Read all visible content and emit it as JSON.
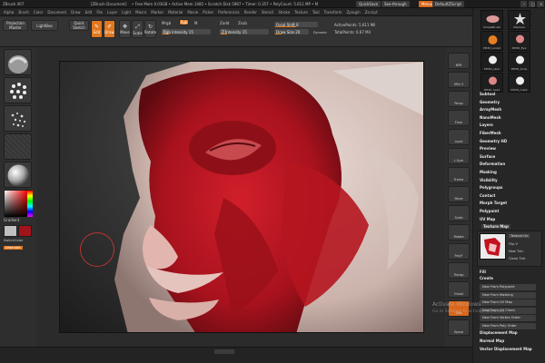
{
  "titlebar": {
    "app": "ZBrush 4R7",
    "doc": "[ZBrush Document]",
    "stats": "• Free Mem 0.03GB • Active Mem 1485 • Scratch Disk 5987 • Timer: 0.357 • PolyCount: 5.611 MP • M",
    "quicksave": "QuickSave",
    "seethrough": "See-through",
    "menus": "Menus",
    "defaultzscript": "DefaultZScript"
  },
  "menubar": [
    "Alpha",
    "Brush",
    "Color",
    "Document",
    "Draw",
    "Edit",
    "File",
    "Layer",
    "Light",
    "Macro",
    "Marker",
    "Material",
    "Movie",
    "Picker",
    "Preferences",
    "Render",
    "Stencil",
    "Stroke",
    "Texture",
    "Tool",
    "Transform",
    "Zplugin",
    "Zscript"
  ],
  "toolbar": {
    "projection_master": "Projection Master",
    "lightbox": "LightBox",
    "quick_sketch": "Quick Sketch",
    "edit": "Edit",
    "draw": "Draw",
    "move": "Move",
    "scale": "Scale",
    "rotate": "Rotate",
    "mrgb": "Mrgb",
    "rgb": "Rgb",
    "m": "M",
    "rgb_intensity": "Rgb Intensity 15",
    "zadd": "Zadd",
    "zsub": "Zsub",
    "z_intensity": "Z Intensity 15",
    "focal_shift": "Focal Shift 0",
    "draw_size": "Draw Size 20",
    "dynamic": "Dynamic",
    "active_points": "ActivePoints: 5.611 Mil",
    "total_points": "TotalPoints: 6.67 Mil"
  },
  "left": {
    "gradient": "Gradient",
    "switchcolor": "SwitchColor",
    "alternate": "Alternate",
    "colors": {
      "main": "#c0c0c0",
      "secondary": "#a0141a",
      "accent": "#e0781f"
    }
  },
  "right": {
    "buttons": [
      "BPR",
      "SPix 3",
      "Persp",
      "Floor",
      "Local",
      "L.Sym",
      "Frame",
      "Move",
      "Scale",
      "Rotate",
      "PolyF",
      "Transp",
      "Ghost",
      "Solo",
      "Xpose"
    ]
  },
  "tray": {
    "thumbs": [
      "SimpleBrush",
      "ZSphere",
      "PM3D_sculpt",
      "PM3D_Eye",
      "PM3D_skull",
      "PM3D_body",
      "PM3D_head",
      "PM3D_mask"
    ],
    "menu": [
      "Subtool",
      "Geometry",
      "ArrayMesh",
      "NanoMesh",
      "Layers",
      "FiberMesh",
      "Geometry HD",
      "Preview",
      "Surface",
      "Deformation",
      "Masking",
      "Visibility",
      "Polygroups",
      "Contact",
      "Morph Target",
      "Polypaint",
      "UV Map",
      "Texture Map"
    ],
    "texture_on": "Texture On",
    "flip_v": "Flip V",
    "new_txtr": "New Txtr",
    "clone_txtr": "Clone Txtr",
    "fill": "Fill",
    "create": "Create",
    "create_items": [
      "New From Polypaint",
      "New From Masking",
      "New From UV Map",
      "New From UV Check",
      "New From Vertex Order",
      "New From Poly Order"
    ],
    "bottom_menu": [
      "Displacement Map",
      "Normal Map",
      "Vector Displacement Map"
    ]
  },
  "watermark": {
    "line1": "Activate Windows",
    "line2": "Go to Settings to activate Windows."
  }
}
